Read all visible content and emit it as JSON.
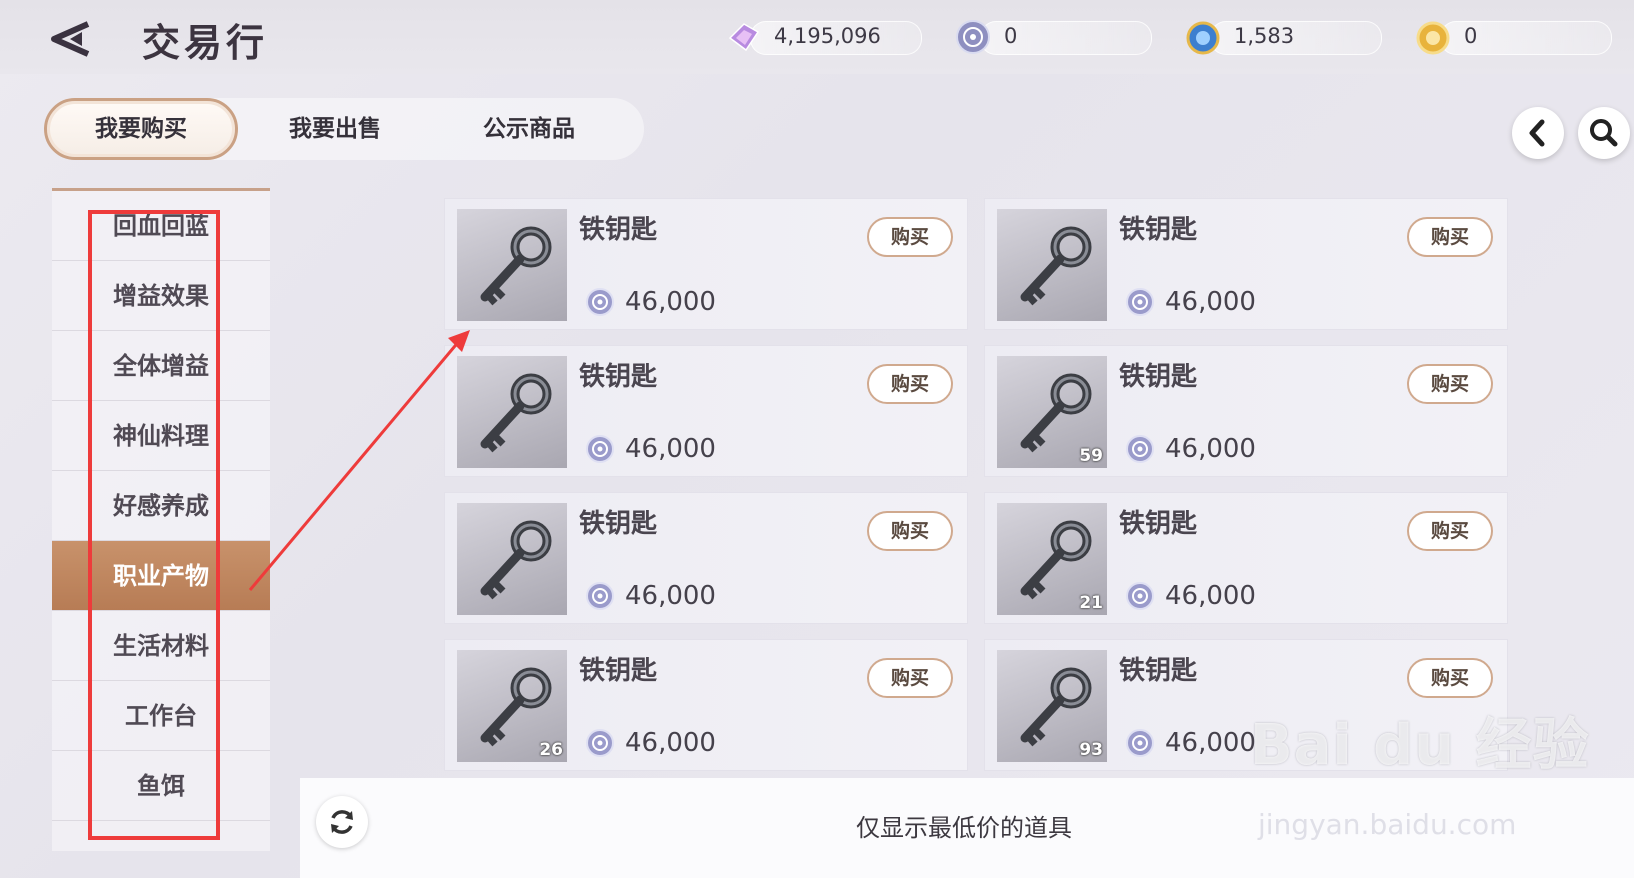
{
  "header": {
    "title": "交易行",
    "currencies": [
      {
        "icon": "crystal-icon",
        "value": "4,195,096"
      },
      {
        "icon": "silver-coin-icon",
        "value": "0"
      },
      {
        "icon": "blue-gem-coin-icon",
        "value": "1,583"
      },
      {
        "icon": "gold-coin-icon",
        "value": "0"
      }
    ]
  },
  "tabs": [
    {
      "label": "我要购买",
      "active": true
    },
    {
      "label": "我要出售",
      "active": false
    },
    {
      "label": "公示商品",
      "active": false
    }
  ],
  "categories": [
    {
      "label": "回血回蓝"
    },
    {
      "label": "增益效果"
    },
    {
      "label": "全体增益"
    },
    {
      "label": "神仙料理"
    },
    {
      "label": "好感养成"
    },
    {
      "label": "职业产物",
      "active": true
    },
    {
      "label": "生活材料"
    },
    {
      "label": "工作台"
    },
    {
      "label": "鱼饵"
    }
  ],
  "items": [
    {
      "name": "铁钥匙",
      "price": "46,000",
      "buy": "购买",
      "qty": ""
    },
    {
      "name": "铁钥匙",
      "price": "46,000",
      "buy": "购买",
      "qty": ""
    },
    {
      "name": "铁钥匙",
      "price": "46,000",
      "buy": "购买",
      "qty": ""
    },
    {
      "name": "铁钥匙",
      "price": "46,000",
      "buy": "购买",
      "qty": "59"
    },
    {
      "name": "铁钥匙",
      "price": "46,000",
      "buy": "购买",
      "qty": ""
    },
    {
      "name": "铁钥匙",
      "price": "46,000",
      "buy": "购买",
      "qty": "21"
    },
    {
      "name": "铁钥匙",
      "price": "46,000",
      "buy": "购买",
      "qty": "26"
    },
    {
      "name": "铁钥匙",
      "price": "46,000",
      "buy": "购买",
      "qty": "93"
    }
  ],
  "footer": {
    "note": "仅显示最低价的道具"
  },
  "watermark": {
    "brand": "Bai du 经验",
    "url": "jingyan.baidu.com"
  },
  "colors": {
    "accent": "#c8926b",
    "highlight_box": "#ee3b3b"
  }
}
